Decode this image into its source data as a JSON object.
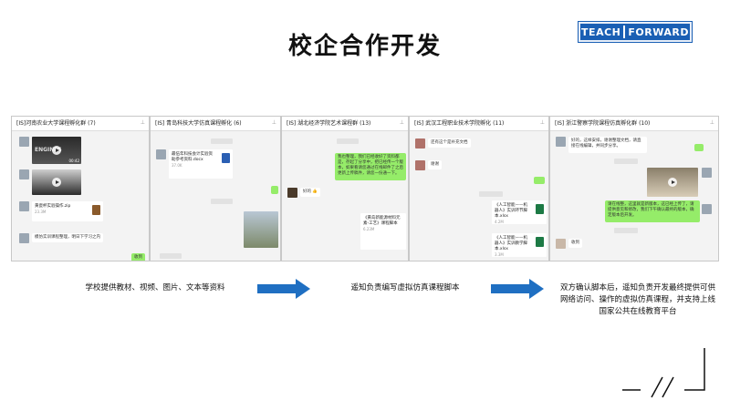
{
  "slide": {
    "title": "校企合作开发"
  },
  "logo": {
    "part1": "TEACH",
    "part2": "FORWARD"
  },
  "panels": [
    {
      "title": "[IS]河南农业大学课程孵化群 (7)",
      "video_caption": "ENGINES",
      "video_time": "00:42",
      "file_name": "黄瓷杯实验操作.zip",
      "file_size": "23.3M",
      "message": "模仿实训课程整理，明日下学习之内",
      "my_reply": "收到"
    },
    {
      "title": "[IS] 青岛科技大学仿真课程孵化 (6)",
      "file_name": "最伍年科技会计实验资助参考资料.docx",
      "file_size": "37.0K",
      "file2_name": "《黄岛新能源材料元素-工艺》课程脚本",
      "file2_size": "6.23M"
    },
    {
      "title": "[IS] 湖北经济学院艺术课程群 (13)",
      "message": "我也整理，我们已经收好了资料都是，存起了分享中，把已经传一个版本，如果看请您通过在线邮件了之后更新上传稿件，请您一份通一下。",
      "reply": "好的 👍"
    },
    {
      "title": "[IS] 武汉工程职业技术学院孵化 (11)",
      "message": "还有这个是补充文档",
      "reply": "谢谢",
      "file_name": "《人工智能——机器人》实训环节脚本.xlsx",
      "file_size": "4.2M",
      "file2_name": "《人工智能——机器人》实训教学脚本.xlsx",
      "file2_size": "3.3M"
    },
    {
      "title": "[IS] 浙江警察学院课程仿真孵化群 (10)",
      "message": "好的，这样安排，谢谢整理文档，请直接在线编辑，并同步分享。",
      "message2": "请在线整，这里就是新版本，这已经上传了，请提供意见和修改，我们下午确认最终的版本，确定版本后开发。",
      "my_reply": "收到",
      "reply2": "收到"
    }
  ],
  "steps": [
    {
      "text": "学校提供教材、视频、图片、文本等资料"
    },
    {
      "text": "遥知负责编写虚拟仿真课程脚本"
    },
    {
      "text": "双方确认脚本后，遥知负责开发最终提供可供网络访问、操作的虚拟仿真课程，并支持上线国家公共在线教育平台"
    }
  ],
  "colors": {
    "accent": "#1a5fb4",
    "arrow": "#1f6fc2",
    "chat_green": "#95ec69"
  }
}
